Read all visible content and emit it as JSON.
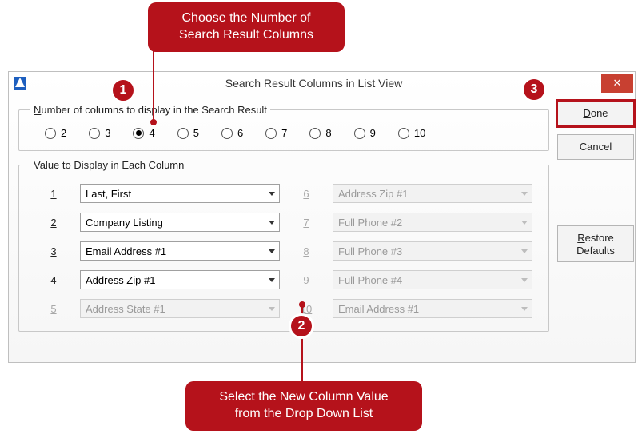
{
  "callouts": {
    "top_line1": "Choose the Number of",
    "top_line2": "Search Result Columns",
    "bottom_line1": "Select the New Column Value",
    "bottom_line2": "from the Drop Down List"
  },
  "badges": {
    "b1": "1",
    "b2": "2",
    "b3": "3"
  },
  "dialog": {
    "title": "Search Result Columns in List View",
    "close_glyph": "✕",
    "group_numcols": {
      "legend_prefix": "N",
      "legend_rest": "umber of columns to display in the Search Result",
      "options": [
        "2",
        "3",
        "4",
        "5",
        "6",
        "7",
        "8",
        "9",
        "10"
      ],
      "selected": "4"
    },
    "group_values": {
      "legend": "Value to Display in Each Column",
      "rows": [
        {
          "n": "1",
          "value": "Last, First",
          "enabled": true
        },
        {
          "n": "2",
          "value": "Company Listing",
          "enabled": true
        },
        {
          "n": "3",
          "value": "Email Address #1",
          "enabled": true
        },
        {
          "n": "4",
          "value": "Address Zip #1",
          "enabled": true
        },
        {
          "n": "5",
          "value": "Address State #1",
          "enabled": false
        },
        {
          "n": "6",
          "value": "Address Zip #1",
          "enabled": false
        },
        {
          "n": "7",
          "value": "Full Phone #2",
          "enabled": false
        },
        {
          "n": "8",
          "value": "Full Phone #3",
          "enabled": false
        },
        {
          "n": "9",
          "value": "Full Phone #4",
          "enabled": false
        },
        {
          "n": "10",
          "value": "Email Address #1",
          "enabled": false
        }
      ]
    },
    "buttons": {
      "done_prefix": "D",
      "done_rest": "one",
      "cancel": "Cancel",
      "restore_prefix": "R",
      "restore_rest": "estore",
      "restore_line2": "Defaults"
    }
  }
}
